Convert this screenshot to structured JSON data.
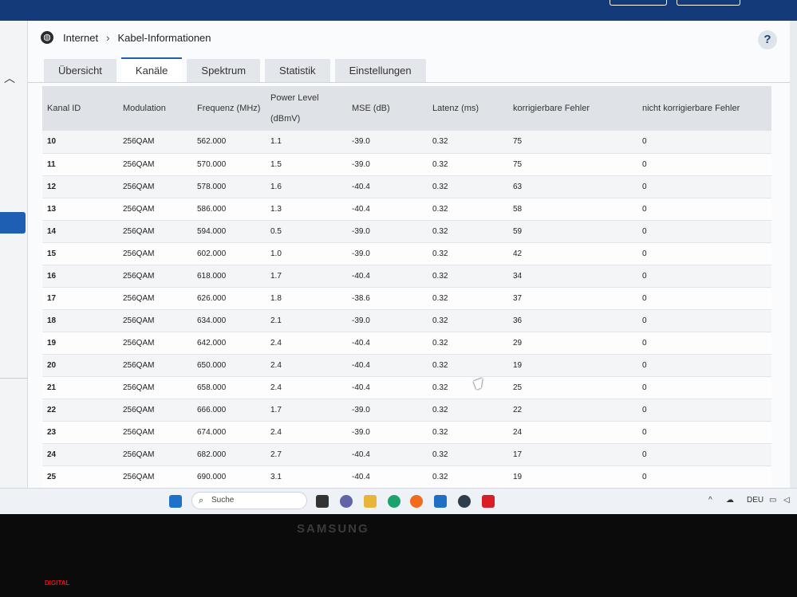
{
  "breadcrumb": {
    "root": "Internet",
    "separator": "›",
    "current": "Kabel-Informationen"
  },
  "help_label": "?",
  "tabs": [
    {
      "label": "Übersicht",
      "active": false
    },
    {
      "label": "Kanäle",
      "active": true
    },
    {
      "label": "Spektrum",
      "active": false
    },
    {
      "label": "Statistik",
      "active": false
    },
    {
      "label": "Einstellungen",
      "active": false
    }
  ],
  "table": {
    "headers": [
      "Kanal ID",
      "Modulation",
      "Frequenz (MHz)",
      "Power Level (dBmV)",
      "MSE (dB)",
      "Latenz (ms)",
      "korrigierbare Fehler",
      "nicht korrigierbare Fehler"
    ],
    "rows": [
      [
        "10",
        "256QAM",
        "562.000",
        "1.1",
        "-39.0",
        "0.32",
        "75",
        "0"
      ],
      [
        "11",
        "256QAM",
        "570.000",
        "1.5",
        "-39.0",
        "0.32",
        "75",
        "0"
      ],
      [
        "12",
        "256QAM",
        "578.000",
        "1.6",
        "-40.4",
        "0.32",
        "63",
        "0"
      ],
      [
        "13",
        "256QAM",
        "586.000",
        "1.3",
        "-40.4",
        "0.32",
        "58",
        "0"
      ],
      [
        "14",
        "256QAM",
        "594.000",
        "0.5",
        "-39.0",
        "0.32",
        "59",
        "0"
      ],
      [
        "15",
        "256QAM",
        "602.000",
        "1.0",
        "-39.0",
        "0.32",
        "42",
        "0"
      ],
      [
        "16",
        "256QAM",
        "618.000",
        "1.7",
        "-40.4",
        "0.32",
        "34",
        "0"
      ],
      [
        "17",
        "256QAM",
        "626.000",
        "1.8",
        "-38.6",
        "0.32",
        "37",
        "0"
      ],
      [
        "18",
        "256QAM",
        "634.000",
        "2.1",
        "-39.0",
        "0.32",
        "36",
        "0"
      ],
      [
        "19",
        "256QAM",
        "642.000",
        "2.4",
        "-40.4",
        "0.32",
        "29",
        "0"
      ],
      [
        "20",
        "256QAM",
        "650.000",
        "2.4",
        "-40.4",
        "0.32",
        "19",
        "0"
      ],
      [
        "21",
        "256QAM",
        "658.000",
        "2.4",
        "-40.4",
        "0.32",
        "25",
        "0"
      ],
      [
        "22",
        "256QAM",
        "666.000",
        "1.7",
        "-39.0",
        "0.32",
        "22",
        "0"
      ],
      [
        "23",
        "256QAM",
        "674.000",
        "2.4",
        "-39.0",
        "0.32",
        "24",
        "0"
      ],
      [
        "24",
        "256QAM",
        "682.000",
        "2.7",
        "-40.4",
        "0.32",
        "17",
        "0"
      ],
      [
        "25",
        "256QAM",
        "690.000",
        "3.1",
        "-40.4",
        "0.32",
        "19",
        "0"
      ]
    ]
  },
  "taskbar": {
    "search_label": "Suche",
    "language": "DEU"
  },
  "monitor": {
    "brand": "SAMSUNG",
    "mode": "DIGITAL"
  },
  "colors": {
    "brand_blue": "#153a7a",
    "accent": "#1e5fb4"
  }
}
